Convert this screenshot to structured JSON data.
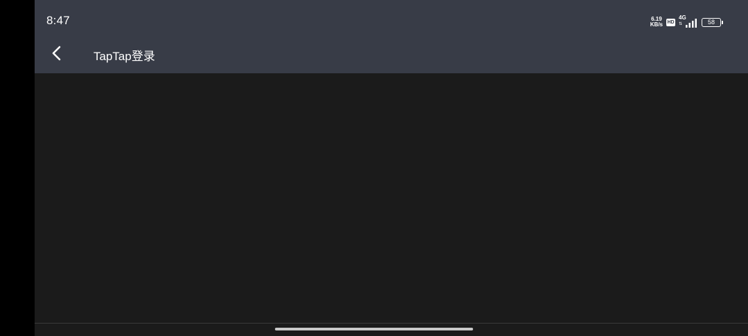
{
  "status_bar": {
    "time": "8:47",
    "net_speed_value": "6.19",
    "net_speed_unit": "KB/s",
    "hd_label": "HD",
    "network_type": "4G",
    "battery_level": "58"
  },
  "header": {
    "back_icon": "chevron-left-icon",
    "title": "TapTap登录"
  },
  "colors": {
    "header_bg": "#383c47",
    "content_bg": "#1b1b1b",
    "text": "#ffffff"
  }
}
